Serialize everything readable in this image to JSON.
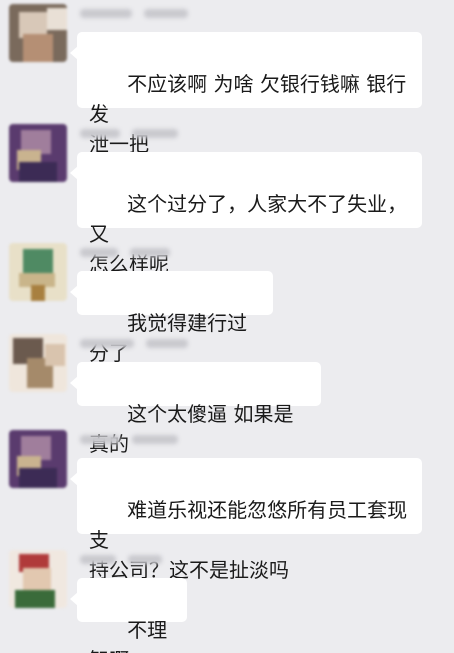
{
  "chat": {
    "messages": [
      {
        "text": "不应该啊 为啥 欠银行钱嘛 银行发\n泄一把",
        "avatar_colors": [
          "#7a6a5c",
          "#d8c8b8",
          "#b58f74",
          "#e9e0d6"
        ]
      },
      {
        "text": "这个过分了，人家大不了失业，又\n怎么样呢",
        "avatar_colors": [
          "#5a3b6e",
          "#a07e9c",
          "#c9b38f",
          "#3c2b55"
        ]
      },
      {
        "text": "我觉得建行过分了",
        "avatar_colors": [
          "#4f8a63",
          "#c9b58a",
          "#a88040",
          "#e8e0c8"
        ]
      },
      {
        "text": "这个太傻逼 如果是真的",
        "avatar_colors": [
          "#6b5a4e",
          "#d9c4ae",
          "#a58a6a",
          "#efe6dc"
        ]
      },
      {
        "text": "难道乐视还能忽悠所有员工套现支\n持公司？这不是扯淡吗",
        "avatar_colors": [
          "#5a3b6e",
          "#a07e9c",
          "#c9b38f",
          "#3c2b55"
        ]
      },
      {
        "text": "不理智啊",
        "avatar_colors": [
          "#b03a3a",
          "#3a6b3a",
          "#e2c8b0",
          "#f0e8e0"
        ]
      }
    ]
  }
}
